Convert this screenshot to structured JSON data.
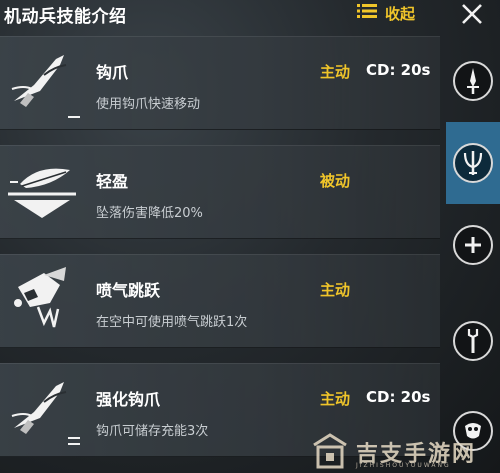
{
  "header": {
    "title": "机动兵技能介绍",
    "collapse_label": "收起",
    "collapse_icon": "list-icon",
    "close_icon": "close-icon"
  },
  "skills": [
    {
      "name": "钩爪",
      "desc": "使用钩爪快速移动",
      "type": "主动",
      "cd": "CD: 20s",
      "icon": "grapple-hook-icon"
    },
    {
      "name": "轻盈",
      "desc": "坠落伤害降低20%",
      "type": "被动",
      "cd": "",
      "icon": "feather-fall-icon"
    },
    {
      "name": "喷气跳跃",
      "desc": "在空中可使用喷气跳跃1次",
      "type": "主动",
      "cd": "",
      "icon": "jet-jump-icon"
    },
    {
      "name": "强化钩爪",
      "desc": "钩爪可储存充能3次",
      "type": "主动",
      "cd": "CD: 20s",
      "icon": "enhanced-grapple-icon"
    }
  ],
  "side_tabs": [
    {
      "icon": "dagger-icon",
      "active": false
    },
    {
      "icon": "trident-icon",
      "active": true
    },
    {
      "icon": "plus-icon",
      "active": false
    },
    {
      "icon": "wrench-icon",
      "active": false
    },
    {
      "icon": "mask-icon",
      "active": false
    }
  ],
  "watermark": {
    "text": "吉支手游网",
    "sub": "JIZHISHOUYOUWANG"
  },
  "colors": {
    "accent": "#f0c52a",
    "active_tab": "#2f6b91",
    "panel": "#3a4248"
  }
}
